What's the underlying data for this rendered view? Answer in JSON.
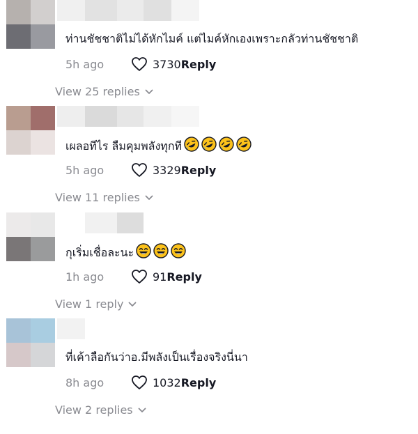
{
  "comments": [
    {
      "text": "ท่านชัชชาติไม่ได้หักไมค์ แต่ไมค์หักเองเพราะกลัวท่านชัชชาติ",
      "time": "5h ago",
      "likes": "3730",
      "reply_label": "Reply",
      "view_replies": "View 25 replies",
      "emoji_count": 0,
      "emoji_type": "",
      "avatar_colors": [
        "#b6b1ae",
        "#d2cfce",
        "#6d6d73",
        "#999aa0"
      ],
      "username_colors": [
        "#f0f0f0",
        "#e2e2e2",
        "#ebebeb",
        "#e0e0e0",
        "#f4f4f4"
      ]
    },
    {
      "text": "เผลอทีไร ลืมคุมพลังทุกที",
      "time": "5h ago",
      "likes": "3329",
      "reply_label": "Reply",
      "view_replies": "View 11 replies",
      "emoji_count": 4,
      "emoji_type": "rofl-emoji",
      "avatar_colors": [
        "#b99d90",
        "#a06e6b",
        "#dcd3d0",
        "#ebe3e2"
      ],
      "username_colors": [
        "#eeeeee",
        "#dadada",
        "#e6e6e6",
        "#f0f0f0",
        "#f6f6f6"
      ]
    },
    {
      "text": "กุเริ่มเชื่อละนะ",
      "time": "1h ago",
      "likes": "91",
      "reply_label": "Reply",
      "view_replies": "View 1 reply",
      "emoji_count": 3,
      "emoji_type": "laughing-emoji",
      "avatar_colors": [
        "#eceaea",
        "#e8e8e8",
        "#7a7677",
        "#9a9b9c"
      ],
      "username_colors": [
        "#ffffff",
        "#f1f1f1",
        "#dddddd",
        "#ffffff",
        "#ffffff"
      ]
    },
    {
      "text": "ที่เค้าลือกันว่าอ.มีพลังเป็นเรื่องจริงนี่นา",
      "time": "8h ago",
      "likes": "1032",
      "reply_label": "Reply",
      "view_replies": "View 2 replies",
      "emoji_count": 0,
      "emoji_type": "",
      "avatar_colors": [
        "#a8c3d8",
        "#a9cde1",
        "#d6c8c9",
        "#d5d6d8"
      ],
      "username_colors": [
        "#f2f2f2",
        "#ffffff",
        "#ffffff",
        "#ffffff",
        "#ffffff"
      ]
    }
  ]
}
